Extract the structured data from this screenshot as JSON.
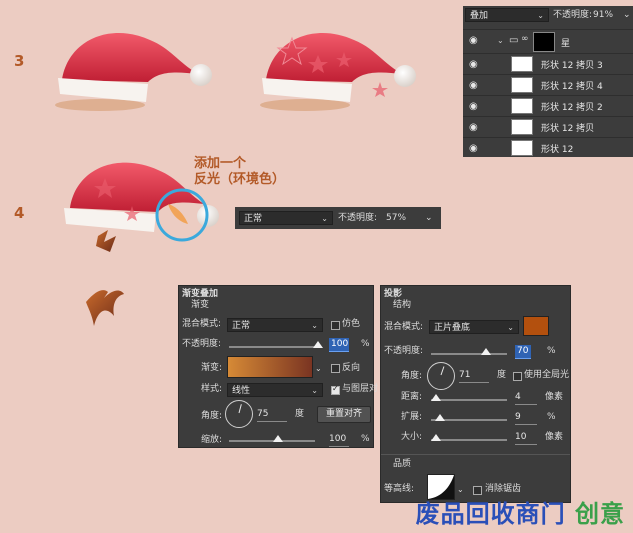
{
  "steps": {
    "step3": "3",
    "step4": "4"
  },
  "annotation": {
    "line1": "添加一个",
    "line2": "反光（环境色）"
  },
  "layers_panel": {
    "blend_mode": "叠加",
    "opacity_label": "不透明度:",
    "opacity_value": "91%",
    "group": {
      "name": "星"
    },
    "layers": [
      {
        "name": "形状 12 拷贝 3"
      },
      {
        "name": "形状 12 拷贝 4"
      },
      {
        "name": "形状 12 拷贝 2"
      },
      {
        "name": "形状 12 拷贝"
      },
      {
        "name": "形状 12"
      }
    ]
  },
  "normal_bar": {
    "mode": "正常",
    "opacity_label": "不透明度:",
    "opacity_value": "57%"
  },
  "gradient_overlay": {
    "title": "渐变叠加",
    "section": "渐变",
    "blend_label": "混合模式:",
    "blend_value": "正常",
    "dither_label": "仿色",
    "opacity_label": "不透明度:",
    "opacity_value": "100",
    "percent": "%",
    "gradient_label": "渐变:",
    "reverse_label": "反向",
    "style_label": "样式:",
    "style_value": "线性",
    "align_label": "与图层对",
    "angle_label": "角度:",
    "angle_value": "75",
    "degree": "度",
    "reset_button": "重置对齐",
    "scale_label": "缩放:",
    "scale_value": "100",
    "scale_percent": "%",
    "colors": {
      "gradient_start": "#d68a36",
      "gradient_end": "#7a3422"
    }
  },
  "drop_shadow": {
    "title": "投影",
    "section": "结构",
    "blend_label": "混合模式:",
    "blend_value": "正片叠底",
    "swatch_color": "#b3500e",
    "opacity_label": "不透明度:",
    "opacity_value": "70",
    "percent": "%",
    "angle_label": "角度:",
    "angle_value": "71",
    "degree": "度",
    "global_light_label": "使用全局光",
    "distance_label": "距离:",
    "distance_value": "4",
    "px": "像素",
    "spread_label": "扩展:",
    "spread_value": "9",
    "spread_unit": "%",
    "size_label": "大小:",
    "size_value": "10",
    "size_unit": "像素",
    "quality_title": "品质",
    "contour_label": "等高线:",
    "antialias_label": "消除锯齿"
  },
  "watermark": {
    "part1": "废品回收商门",
    "part2": "创意"
  }
}
